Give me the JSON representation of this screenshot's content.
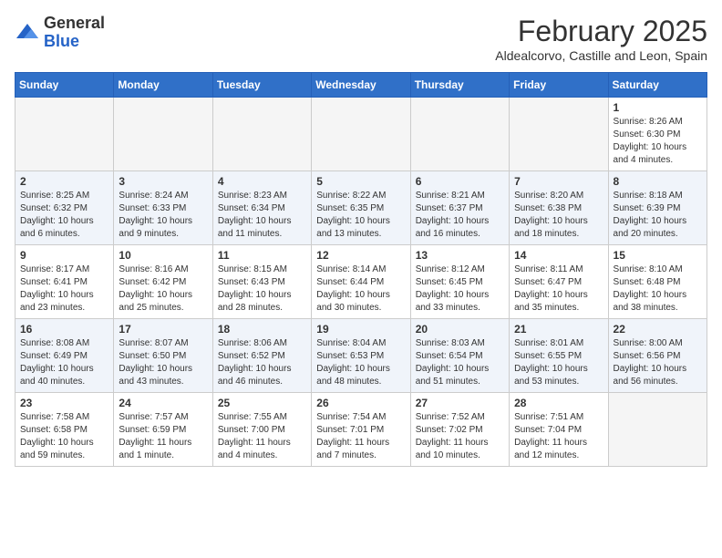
{
  "logo": {
    "general": "General",
    "blue": "Blue"
  },
  "title": "February 2025",
  "subtitle": "Aldealcorvo, Castille and Leon, Spain",
  "weekdays": [
    "Sunday",
    "Monday",
    "Tuesday",
    "Wednesday",
    "Thursday",
    "Friday",
    "Saturday"
  ],
  "weeks": [
    [
      {
        "day": "",
        "info": ""
      },
      {
        "day": "",
        "info": ""
      },
      {
        "day": "",
        "info": ""
      },
      {
        "day": "",
        "info": ""
      },
      {
        "day": "",
        "info": ""
      },
      {
        "day": "",
        "info": ""
      },
      {
        "day": "1",
        "info": "Sunrise: 8:26 AM\nSunset: 6:30 PM\nDaylight: 10 hours and 4 minutes."
      }
    ],
    [
      {
        "day": "2",
        "info": "Sunrise: 8:25 AM\nSunset: 6:32 PM\nDaylight: 10 hours and 6 minutes."
      },
      {
        "day": "3",
        "info": "Sunrise: 8:24 AM\nSunset: 6:33 PM\nDaylight: 10 hours and 9 minutes."
      },
      {
        "day": "4",
        "info": "Sunrise: 8:23 AM\nSunset: 6:34 PM\nDaylight: 10 hours and 11 minutes."
      },
      {
        "day": "5",
        "info": "Sunrise: 8:22 AM\nSunset: 6:35 PM\nDaylight: 10 hours and 13 minutes."
      },
      {
        "day": "6",
        "info": "Sunrise: 8:21 AM\nSunset: 6:37 PM\nDaylight: 10 hours and 16 minutes."
      },
      {
        "day": "7",
        "info": "Sunrise: 8:20 AM\nSunset: 6:38 PM\nDaylight: 10 hours and 18 minutes."
      },
      {
        "day": "8",
        "info": "Sunrise: 8:18 AM\nSunset: 6:39 PM\nDaylight: 10 hours and 20 minutes."
      }
    ],
    [
      {
        "day": "9",
        "info": "Sunrise: 8:17 AM\nSunset: 6:41 PM\nDaylight: 10 hours and 23 minutes."
      },
      {
        "day": "10",
        "info": "Sunrise: 8:16 AM\nSunset: 6:42 PM\nDaylight: 10 hours and 25 minutes."
      },
      {
        "day": "11",
        "info": "Sunrise: 8:15 AM\nSunset: 6:43 PM\nDaylight: 10 hours and 28 minutes."
      },
      {
        "day": "12",
        "info": "Sunrise: 8:14 AM\nSunset: 6:44 PM\nDaylight: 10 hours and 30 minutes."
      },
      {
        "day": "13",
        "info": "Sunrise: 8:12 AM\nSunset: 6:45 PM\nDaylight: 10 hours and 33 minutes."
      },
      {
        "day": "14",
        "info": "Sunrise: 8:11 AM\nSunset: 6:47 PM\nDaylight: 10 hours and 35 minutes."
      },
      {
        "day": "15",
        "info": "Sunrise: 8:10 AM\nSunset: 6:48 PM\nDaylight: 10 hours and 38 minutes."
      }
    ],
    [
      {
        "day": "16",
        "info": "Sunrise: 8:08 AM\nSunset: 6:49 PM\nDaylight: 10 hours and 40 minutes."
      },
      {
        "day": "17",
        "info": "Sunrise: 8:07 AM\nSunset: 6:50 PM\nDaylight: 10 hours and 43 minutes."
      },
      {
        "day": "18",
        "info": "Sunrise: 8:06 AM\nSunset: 6:52 PM\nDaylight: 10 hours and 46 minutes."
      },
      {
        "day": "19",
        "info": "Sunrise: 8:04 AM\nSunset: 6:53 PM\nDaylight: 10 hours and 48 minutes."
      },
      {
        "day": "20",
        "info": "Sunrise: 8:03 AM\nSunset: 6:54 PM\nDaylight: 10 hours and 51 minutes."
      },
      {
        "day": "21",
        "info": "Sunrise: 8:01 AM\nSunset: 6:55 PM\nDaylight: 10 hours and 53 minutes."
      },
      {
        "day": "22",
        "info": "Sunrise: 8:00 AM\nSunset: 6:56 PM\nDaylight: 10 hours and 56 minutes."
      }
    ],
    [
      {
        "day": "23",
        "info": "Sunrise: 7:58 AM\nSunset: 6:58 PM\nDaylight: 10 hours and 59 minutes."
      },
      {
        "day": "24",
        "info": "Sunrise: 7:57 AM\nSunset: 6:59 PM\nDaylight: 11 hours and 1 minute."
      },
      {
        "day": "25",
        "info": "Sunrise: 7:55 AM\nSunset: 7:00 PM\nDaylight: 11 hours and 4 minutes."
      },
      {
        "day": "26",
        "info": "Sunrise: 7:54 AM\nSunset: 7:01 PM\nDaylight: 11 hours and 7 minutes."
      },
      {
        "day": "27",
        "info": "Sunrise: 7:52 AM\nSunset: 7:02 PM\nDaylight: 11 hours and 10 minutes."
      },
      {
        "day": "28",
        "info": "Sunrise: 7:51 AM\nSunset: 7:04 PM\nDaylight: 11 hours and 12 minutes."
      },
      {
        "day": "",
        "info": ""
      }
    ]
  ]
}
